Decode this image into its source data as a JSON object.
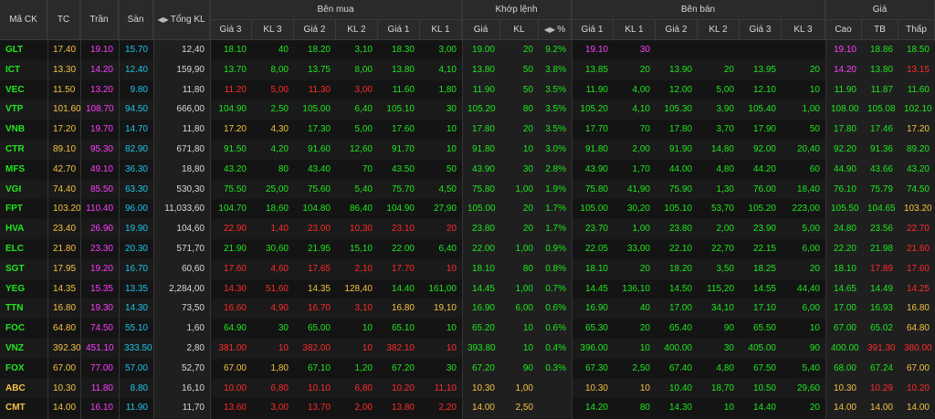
{
  "colors": {
    "up": "#1ee81e",
    "down": "#ff2a2a",
    "ref": "#f5c342",
    "ceil": "#ff3dff",
    "floor": "#19c6ea",
    "text": "#d8d8d8"
  },
  "headers": {
    "symbol": "Mã CK",
    "ref": "TC",
    "ceil": "Trần",
    "floor": "Sàn",
    "total_vol": "Tổng KL",
    "bid_group": "Bên mua",
    "match_group": "Khớp lệnh",
    "ask_group": "Bên bán",
    "price_group": "Giá",
    "bid_p3": "Giá 3",
    "bid_v3": "KL 3",
    "bid_p2": "Giá 2",
    "bid_v2": "KL 2",
    "bid_p1": "Giá 1",
    "bid_v1": "KL 1",
    "match_p": "Giá",
    "match_v": "KL",
    "match_pct": "%",
    "ask_p1": "Giá 1",
    "ask_v1": "KL 1",
    "ask_p2": "Giá 2",
    "ask_v2": "KL 2",
    "ask_p3": "Giá 3",
    "ask_v3": "KL 3",
    "high": "Cao",
    "avg": "TB",
    "low": "Thấp"
  },
  "rows": [
    {
      "sym": "GLT",
      "c": "up",
      "ref": "17.40",
      "ceil": "19.10",
      "floor": "15.70",
      "vol": "12,40",
      "b3p": "18.10",
      "b3pc": "up",
      "b3v": "40",
      "b2p": "18.20",
      "b2pc": "up",
      "b2v": "3,10",
      "b1p": "18.30",
      "b1pc": "up",
      "b1v": "3,00",
      "mp": "19.00",
      "mpc": "up",
      "mv": "20",
      "pct": "9.2%",
      "a1p": "19.10",
      "a1pc": "ceil",
      "a1v": "30",
      "a2p": "",
      "a2pc": "up",
      "a2v": "",
      "a3p": "",
      "a3pc": "up",
      "a3v": "",
      "hi": "19.10",
      "hic": "ceil",
      "avg": "18.86",
      "avgc": "up",
      "lo": "18.50",
      "loc": "up"
    },
    {
      "sym": "ICT",
      "c": "up",
      "ref": "13.30",
      "ceil": "14.20",
      "floor": "12.40",
      "vol": "159,90",
      "b3p": "13.70",
      "b3pc": "up",
      "b3v": "8,00",
      "b2p": "13.75",
      "b2pc": "up",
      "b2v": "8,00",
      "b1p": "13.80",
      "b1pc": "up",
      "b1v": "4,10",
      "mp": "13.80",
      "mpc": "up",
      "mv": "50",
      "pct": "3.8%",
      "a1p": "13.85",
      "a1pc": "up",
      "a1v": "20",
      "a2p": "13.90",
      "a2pc": "up",
      "a2v": "20",
      "a3p": "13.95",
      "a3pc": "up",
      "a3v": "20",
      "hi": "14.20",
      "hic": "ceil",
      "avg": "13.80",
      "avgc": "up",
      "lo": "13.15",
      "loc": "down"
    },
    {
      "sym": "VEC",
      "c": "up",
      "ref": "11.50",
      "ceil": "13.20",
      "floor": "9.80",
      "vol": "11,80",
      "b3p": "11.20",
      "b3pc": "down",
      "b3v": "5,00",
      "b2p": "11.30",
      "b2pc": "down",
      "b2v": "3,00",
      "b1p": "11.60",
      "b1pc": "up",
      "b1v": "1,80",
      "mp": "11.90",
      "mpc": "up",
      "mv": "50",
      "pct": "3.5%",
      "a1p": "11.90",
      "a1pc": "up",
      "a1v": "4,00",
      "a2p": "12.00",
      "a2pc": "up",
      "a2v": "5,00",
      "a3p": "12.10",
      "a3pc": "up",
      "a3v": "10",
      "hi": "11.90",
      "hic": "up",
      "avg": "11.87",
      "avgc": "up",
      "lo": "11.60",
      "loc": "up"
    },
    {
      "sym": "VTP",
      "c": "up",
      "ref": "101.60",
      "ceil": "108.70",
      "floor": "94.50",
      "vol": "666,00",
      "b3p": "104.90",
      "b3pc": "up",
      "b3v": "2,50",
      "b2p": "105.00",
      "b2pc": "up",
      "b2v": "6,40",
      "b1p": "105.10",
      "b1pc": "up",
      "b1v": "30",
      "mp": "105.20",
      "mpc": "up",
      "mv": "80",
      "pct": "3.5%",
      "a1p": "105.20",
      "a1pc": "up",
      "a1v": "4,10",
      "a2p": "105.30",
      "a2pc": "up",
      "a2v": "3,90",
      "a3p": "105.40",
      "a3pc": "up",
      "a3v": "1,00",
      "hi": "108.00",
      "hic": "up",
      "avg": "105.08",
      "avgc": "up",
      "lo": "102.10",
      "loc": "up"
    },
    {
      "sym": "VNB",
      "c": "up",
      "ref": "17.20",
      "ceil": "19.70",
      "floor": "14.70",
      "vol": "11,80",
      "b3p": "17.20",
      "b3pc": "ref",
      "b3v": "4,30",
      "b2p": "17.30",
      "b2pc": "up",
      "b2v": "5,00",
      "b1p": "17.60",
      "b1pc": "up",
      "b1v": "10",
      "mp": "17.80",
      "mpc": "up",
      "mv": "20",
      "pct": "3.5%",
      "a1p": "17.70",
      "a1pc": "up",
      "a1v": "70",
      "a2p": "17.80",
      "a2pc": "up",
      "a2v": "3,70",
      "a3p": "17.90",
      "a3pc": "up",
      "a3v": "50",
      "hi": "17.80",
      "hic": "up",
      "avg": "17.46",
      "avgc": "up",
      "lo": "17.20",
      "loc": "ref"
    },
    {
      "sym": "CTR",
      "c": "up",
      "ref": "89.10",
      "ceil": "95.30",
      "floor": "82.90",
      "vol": "671,80",
      "b3p": "91.50",
      "b3pc": "up",
      "b3v": "4,20",
      "b2p": "91.60",
      "b2pc": "up",
      "b2v": "12,60",
      "b1p": "91.70",
      "b1pc": "up",
      "b1v": "10",
      "mp": "91.80",
      "mpc": "up",
      "mv": "10",
      "pct": "3.0%",
      "a1p": "91.80",
      "a1pc": "up",
      "a1v": "2,00",
      "a2p": "91.90",
      "a2pc": "up",
      "a2v": "14,80",
      "a3p": "92.00",
      "a3pc": "up",
      "a3v": "20,40",
      "hi": "92.20",
      "hic": "up",
      "avg": "91.36",
      "avgc": "up",
      "lo": "89.20",
      "loc": "up"
    },
    {
      "sym": "MFS",
      "c": "up",
      "ref": "42.70",
      "ceil": "49.10",
      "floor": "36.30",
      "vol": "18,80",
      "b3p": "43.20",
      "b3pc": "up",
      "b3v": "80",
      "b2p": "43.40",
      "b2pc": "up",
      "b2v": "70",
      "b1p": "43.50",
      "b1pc": "up",
      "b1v": "50",
      "mp": "43.90",
      "mpc": "up",
      "mv": "30",
      "pct": "2.8%",
      "a1p": "43.90",
      "a1pc": "up",
      "a1v": "1,70",
      "a2p": "44.00",
      "a2pc": "up",
      "a2v": "4,80",
      "a3p": "44.20",
      "a3pc": "up",
      "a3v": "60",
      "hi": "44.90",
      "hic": "up",
      "avg": "43.66",
      "avgc": "up",
      "lo": "43.20",
      "loc": "up"
    },
    {
      "sym": "VGI",
      "c": "up",
      "ref": "74.40",
      "ceil": "85.50",
      "floor": "63.30",
      "vol": "530,30",
      "b3p": "75.50",
      "b3pc": "up",
      "b3v": "25,00",
      "b2p": "75.60",
      "b2pc": "up",
      "b2v": "5,40",
      "b1p": "75.70",
      "b1pc": "up",
      "b1v": "4,50",
      "mp": "75.80",
      "mpc": "up",
      "mv": "1,00",
      "pct": "1.9%",
      "a1p": "75.80",
      "a1pc": "up",
      "a1v": "41,90",
      "a2p": "75.90",
      "a2pc": "up",
      "a2v": "1,30",
      "a3p": "76.00",
      "a3pc": "up",
      "a3v": "18,40",
      "hi": "76.10",
      "hic": "up",
      "avg": "75.79",
      "avgc": "up",
      "lo": "74.50",
      "loc": "up"
    },
    {
      "sym": "FPT",
      "c": "up",
      "ref": "103.20",
      "ceil": "110.40",
      "floor": "96.00",
      "vol": "11,033,60",
      "b3p": "104.70",
      "b3pc": "up",
      "b3v": "18,60",
      "b2p": "104.80",
      "b2pc": "up",
      "b2v": "86,40",
      "b1p": "104.90",
      "b1pc": "up",
      "b1v": "27,90",
      "mp": "105.00",
      "mpc": "up",
      "mv": "20",
      "pct": "1.7%",
      "a1p": "105.00",
      "a1pc": "up",
      "a1v": "30,20",
      "a2p": "105.10",
      "a2pc": "up",
      "a2v": "53,70",
      "a3p": "105.20",
      "a3pc": "up",
      "a3v": "223,00",
      "hi": "105.50",
      "hic": "up",
      "avg": "104.65",
      "avgc": "up",
      "lo": "103.20",
      "loc": "ref"
    },
    {
      "sym": "HVA",
      "c": "up",
      "ref": "23.40",
      "ceil": "26.90",
      "floor": "19.90",
      "vol": "104,60",
      "b3p": "22.90",
      "b3pc": "down",
      "b3v": "1,40",
      "b2p": "23.00",
      "b2pc": "down",
      "b2v": "10,30",
      "b1p": "23.10",
      "b1pc": "down",
      "b1v": "20",
      "mp": "23.80",
      "mpc": "up",
      "mv": "20",
      "pct": "1.7%",
      "a1p": "23.70",
      "a1pc": "up",
      "a1v": "1,00",
      "a2p": "23.80",
      "a2pc": "up",
      "a2v": "2,00",
      "a3p": "23.90",
      "a3pc": "up",
      "a3v": "5,00",
      "hi": "24.80",
      "hic": "up",
      "avg": "23.56",
      "avgc": "up",
      "lo": "22.70",
      "loc": "down"
    },
    {
      "sym": "ELC",
      "c": "up",
      "ref": "21.80",
      "ceil": "23.30",
      "floor": "20.30",
      "vol": "571,70",
      "b3p": "21.90",
      "b3pc": "up",
      "b3v": "30,60",
      "b2p": "21.95",
      "b2pc": "up",
      "b2v": "15,10",
      "b1p": "22.00",
      "b1pc": "up",
      "b1v": "6,40",
      "mp": "22.00",
      "mpc": "up",
      "mv": "1,00",
      "pct": "0.9%",
      "a1p": "22.05",
      "a1pc": "up",
      "a1v": "33,00",
      "a2p": "22.10",
      "a2pc": "up",
      "a2v": "22,70",
      "a3p": "22.15",
      "a3pc": "up",
      "a3v": "6,00",
      "hi": "22.20",
      "hic": "up",
      "avg": "21.98",
      "avgc": "up",
      "lo": "21.60",
      "loc": "down"
    },
    {
      "sym": "SGT",
      "c": "up",
      "ref": "17.95",
      "ceil": "19.20",
      "floor": "16.70",
      "vol": "60,60",
      "b3p": "17.60",
      "b3pc": "down",
      "b3v": "4,60",
      "b2p": "17.65",
      "b2pc": "down",
      "b2v": "2,10",
      "b1p": "17.70",
      "b1pc": "down",
      "b1v": "10",
      "mp": "18.10",
      "mpc": "up",
      "mv": "80",
      "pct": "0.8%",
      "a1p": "18.10",
      "a1pc": "up",
      "a1v": "20",
      "a2p": "18.20",
      "a2pc": "up",
      "a2v": "3,50",
      "a3p": "18.25",
      "a3pc": "up",
      "a3v": "20",
      "hi": "18.10",
      "hic": "up",
      "avg": "17.89",
      "avgc": "down",
      "lo": "17.60",
      "loc": "down"
    },
    {
      "sym": "YEG",
      "c": "up",
      "ref": "14.35",
      "ceil": "15.35",
      "floor": "13.35",
      "vol": "2,284,00",
      "b3p": "14.30",
      "b3pc": "down",
      "b3v": "51,60",
      "b2p": "14.35",
      "b2pc": "ref",
      "b2v": "128,40",
      "b1p": "14.40",
      "b1pc": "up",
      "b1v": "161,00",
      "mp": "14.45",
      "mpc": "up",
      "mv": "1,00",
      "pct": "0.7%",
      "a1p": "14.45",
      "a1pc": "up",
      "a1v": "136,10",
      "a2p": "14.50",
      "a2pc": "up",
      "a2v": "115,20",
      "a3p": "14.55",
      "a3pc": "up",
      "a3v": "44,40",
      "hi": "14.65",
      "hic": "up",
      "avg": "14.49",
      "avgc": "up",
      "lo": "14.25",
      "loc": "down"
    },
    {
      "sym": "TTN",
      "c": "up",
      "ref": "16.80",
      "ceil": "19.30",
      "floor": "14.30",
      "vol": "73,50",
      "b3p": "16.60",
      "b3pc": "down",
      "b3v": "4,90",
      "b2p": "16.70",
      "b2pc": "down",
      "b2v": "3,10",
      "b1p": "16.80",
      "b1pc": "ref",
      "b1v": "19,10",
      "mp": "16.90",
      "mpc": "up",
      "mv": "6,00",
      "pct": "0.6%",
      "a1p": "16.90",
      "a1pc": "up",
      "a1v": "40",
      "a2p": "17.00",
      "a2pc": "up",
      "a2v": "34,10",
      "a3p": "17.10",
      "a3pc": "up",
      "a3v": "6,00",
      "hi": "17.00",
      "hic": "up",
      "avg": "16.93",
      "avgc": "up",
      "lo": "16.80",
      "loc": "ref"
    },
    {
      "sym": "FOC",
      "c": "up",
      "ref": "64.80",
      "ceil": "74.50",
      "floor": "55.10",
      "vol": "1,60",
      "b3p": "64.90",
      "b3pc": "up",
      "b3v": "30",
      "b2p": "65.00",
      "b2pc": "up",
      "b2v": "10",
      "b1p": "65.10",
      "b1pc": "up",
      "b1v": "10",
      "mp": "65.20",
      "mpc": "up",
      "mv": "10",
      "pct": "0.6%",
      "a1p": "65.30",
      "a1pc": "up",
      "a1v": "20",
      "a2p": "65.40",
      "a2pc": "up",
      "a2v": "90",
      "a3p": "65.50",
      "a3pc": "up",
      "a3v": "10",
      "hi": "67.00",
      "hic": "up",
      "avg": "65.02",
      "avgc": "up",
      "lo": "64.80",
      "loc": "ref"
    },
    {
      "sym": "VNZ",
      "c": "up",
      "ref": "392.30",
      "ceil": "451.10",
      "floor": "333.50",
      "vol": "2,80",
      "b3p": "381.00",
      "b3pc": "down",
      "b3v": "10",
      "b2p": "382.00",
      "b2pc": "down",
      "b2v": "10",
      "b1p": "382.10",
      "b1pc": "down",
      "b1v": "10",
      "mp": "393.80",
      "mpc": "up",
      "mv": "10",
      "pct": "0.4%",
      "a1p": "396.00",
      "a1pc": "up",
      "a1v": "10",
      "a2p": "400.00",
      "a2pc": "up",
      "a2v": "30",
      "a3p": "405.00",
      "a3pc": "up",
      "a3v": "90",
      "hi": "400.00",
      "hic": "up",
      "avg": "391.30",
      "avgc": "down",
      "lo": "380.00",
      "loc": "down"
    },
    {
      "sym": "FOX",
      "c": "up",
      "ref": "67.00",
      "ceil": "77.00",
      "floor": "57.00",
      "vol": "52,70",
      "b3p": "67.00",
      "b3pc": "ref",
      "b3v": "1,80",
      "b2p": "67.10",
      "b2pc": "up",
      "b2v": "1,20",
      "b1p": "67.20",
      "b1pc": "up",
      "b1v": "30",
      "mp": "67.20",
      "mpc": "up",
      "mv": "90",
      "pct": "0.3%",
      "a1p": "67.30",
      "a1pc": "up",
      "a1v": "2,50",
      "a2p": "67.40",
      "a2pc": "up",
      "a2v": "4,80",
      "a3p": "67.50",
      "a3pc": "up",
      "a3v": "5,40",
      "hi": "68.00",
      "hic": "up",
      "avg": "67.24",
      "avgc": "up",
      "lo": "67.00",
      "loc": "ref"
    },
    {
      "sym": "ABC",
      "c": "ref",
      "ref": "10.30",
      "ceil": "11.80",
      "floor": "8.80",
      "vol": "16,10",
      "b3p": "10.00",
      "b3pc": "down",
      "b3v": "6,80",
      "b2p": "10.10",
      "b2pc": "down",
      "b2v": "6,80",
      "b1p": "10.20",
      "b1pc": "down",
      "b1v": "11,10",
      "mp": "10.30",
      "mpc": "ref",
      "mv": "1,00",
      "pct": "",
      "a1p": "10.30",
      "a1pc": "ref",
      "a1v": "10",
      "a2p": "10.40",
      "a2pc": "up",
      "a2v": "18,70",
      "a3p": "10.50",
      "a3pc": "up",
      "a3v": "29,60",
      "hi": "10.30",
      "hic": "ref",
      "avg": "10.29",
      "avgc": "down",
      "lo": "10.20",
      "loc": "down"
    },
    {
      "sym": "CMT",
      "c": "ref",
      "ref": "14.00",
      "ceil": "16.10",
      "floor": "11.90",
      "vol": "11,70",
      "b3p": "13.60",
      "b3pc": "down",
      "b3v": "3,00",
      "b2p": "13.70",
      "b2pc": "down",
      "b2v": "2,00",
      "b1p": "13.80",
      "b1pc": "down",
      "b1v": "2,20",
      "mp": "14.00",
      "mpc": "ref",
      "mv": "2,50",
      "pct": "",
      "a1p": "14.20",
      "a1pc": "up",
      "a1v": "80",
      "a2p": "14.30",
      "a2pc": "up",
      "a2v": "10",
      "a3p": "14.40",
      "a3pc": "up",
      "a3v": "20",
      "hi": "14.00",
      "hic": "ref",
      "avg": "14.00",
      "avgc": "ref",
      "lo": "14.00",
      "loc": "ref"
    }
  ]
}
